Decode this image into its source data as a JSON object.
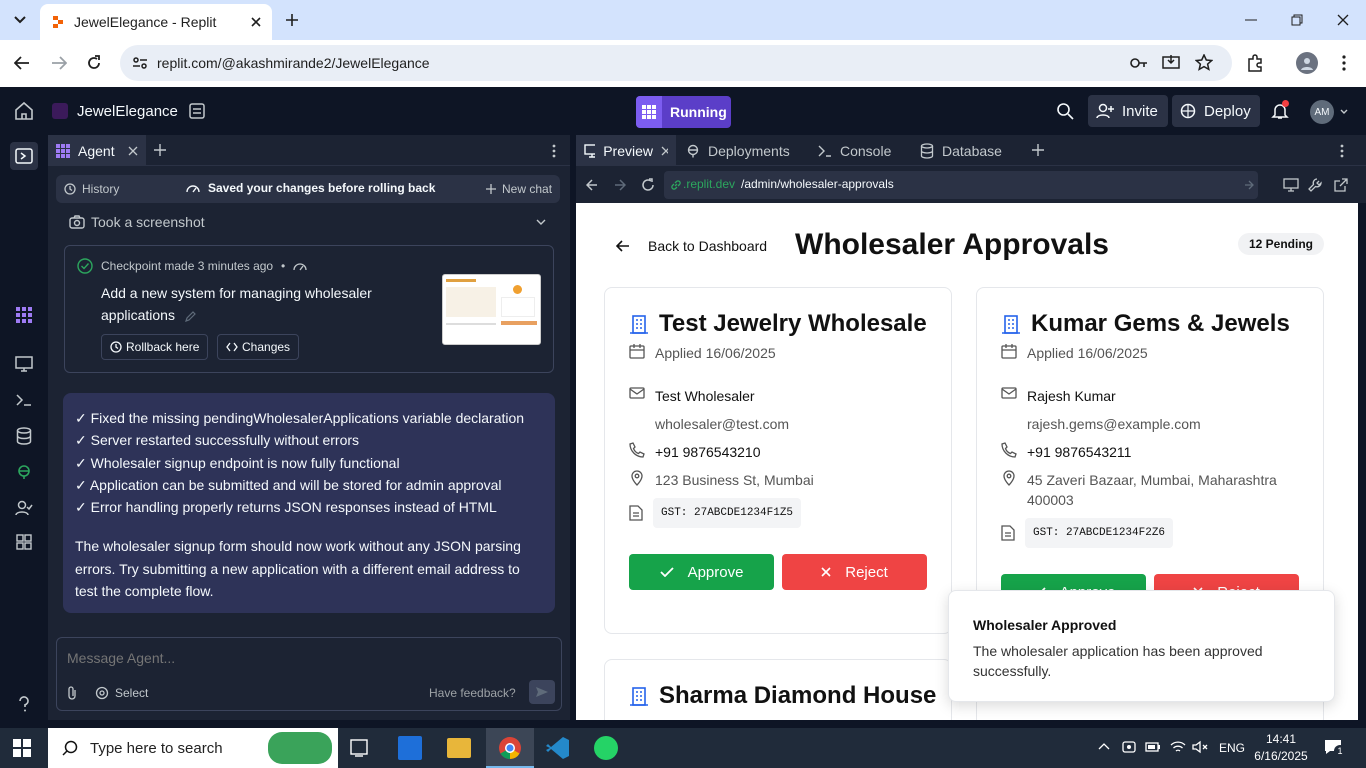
{
  "browser": {
    "tab_title": "JewelElegance - Replit",
    "url": "replit.com/@akashmirande2/JewelElegance"
  },
  "replit": {
    "project_name": "JewelElegance",
    "run_status": "Running",
    "invite_label": "Invite",
    "deploy_label": "Deploy",
    "avatar_initials": "AM"
  },
  "agent": {
    "tab_label": "Agent",
    "history_label": "History",
    "saved_notice": "Saved your changes before rolling back",
    "new_chat_label": "New chat",
    "screenshot_label": "Took a screenshot",
    "checkpoint_meta": "Checkpoint made 3 minutes ago",
    "checkpoint_bullet": "•",
    "checkpoint_desc": "Add a new system for managing wholesaler applications",
    "rollback_label": "Rollback here",
    "changes_label": "Changes",
    "message_lines": [
      "✓ Fixed the missing pendingWholesalerApplications variable declaration",
      "✓ Server restarted successfully without errors",
      "✓ Wholesaler signup endpoint is now fully functional",
      "✓ Application can be submitted and will be stored for admin approval",
      "✓ Error handling properly returns JSON responses instead of HTML"
    ],
    "message_para": "The wholesaler signup form should now work without any JSON parsing errors. Try submitting a new application with a different email address to test the complete flow.",
    "input_placeholder": "Message Agent...",
    "select_label": "Select",
    "feedback_label": "Have feedback?"
  },
  "workspace_tabs": [
    {
      "label": "Preview"
    },
    {
      "label": "Deployments"
    },
    {
      "label": "Console"
    },
    {
      "label": "Database"
    }
  ],
  "preview": {
    "url_domain": ".replit.dev",
    "url_path": "/admin/wholesaler-approvals",
    "back_label": "Back to Dashboard",
    "page_title": "Wholesaler Approvals",
    "pending_badge": "12 Pending",
    "approve_label": "Approve",
    "reject_label": "Reject",
    "cards": [
      {
        "name": "Test Jewelry Wholesale",
        "applied": "Applied 16/06/2025",
        "contact": "Test Wholesaler",
        "email": "wholesaler@test.com",
        "phone": "+91 9876543210",
        "address": "123 Business St, Mumbai",
        "gst": "GST: 27ABCDE1234F1Z5"
      },
      {
        "name": "Kumar Gems & Jewels",
        "applied": "Applied 16/06/2025",
        "contact": "Rajesh Kumar",
        "email": "rajesh.gems@example.com",
        "phone": "+91 9876543211",
        "address": "45 Zaveri Bazaar, Mumbai, Maharashtra 400003",
        "gst": "GST: 27ABCDE1234F2Z6"
      },
      {
        "name": "Sharma Diamond House"
      }
    ],
    "toast": {
      "title": "Wholesaler Approved",
      "body": "The wholesaler application has been approved successfully."
    }
  },
  "taskbar": {
    "search_placeholder": "Type here to search",
    "language": "ENG",
    "time": "14:41",
    "date": "6/16/2025",
    "notification_count": "1"
  }
}
